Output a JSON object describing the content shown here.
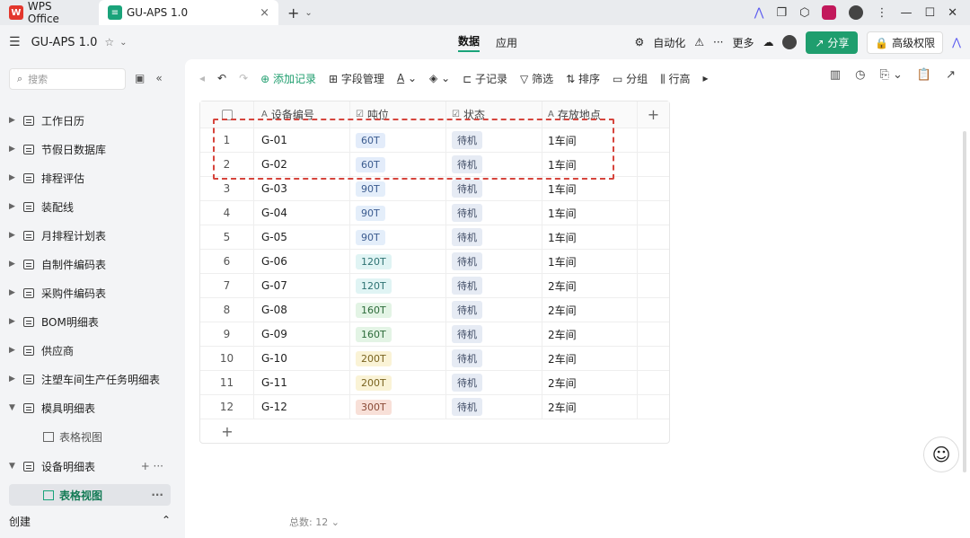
{
  "titlebar": {
    "wps_tab": "WPS Office",
    "doc_tab": "GU-APS 1.0",
    "close": "×",
    "new_tab": "+",
    "menu": "⌄"
  },
  "appbar": {
    "title": "GU-APS 1.0",
    "tabs": [
      {
        "label": "数据",
        "active": true
      },
      {
        "label": "应用",
        "active": false
      }
    ],
    "automation": "自动化",
    "more": "更多",
    "share": "分享",
    "permissions": "高级权限"
  },
  "sidebar": {
    "search_placeholder": "搜索",
    "items": [
      {
        "label": "工作日历"
      },
      {
        "label": "节假日数据库"
      },
      {
        "label": "排程评估"
      },
      {
        "label": "装配线"
      },
      {
        "label": "月排程计划表"
      },
      {
        "label": "自制件编码表"
      },
      {
        "label": "采购件编码表"
      },
      {
        "label": "BOM明细表"
      },
      {
        "label": "供应商"
      },
      {
        "label": "注塑车间生产任务明细表"
      },
      {
        "label": "模具明细表"
      },
      {
        "label": "表格视图"
      },
      {
        "label": "设备明细表"
      },
      {
        "label": "表格视图"
      }
    ],
    "create": "创建"
  },
  "toolbar": {
    "add_record": "添加记录",
    "field_manage": "字段管理",
    "text_a": "A",
    "sub_record": "子记录",
    "filter": "筛选",
    "sort": "排序",
    "group": "分组",
    "row_height": "行高"
  },
  "table": {
    "headers": [
      "设备编号",
      "吨位",
      "状态",
      "存放地点"
    ],
    "rows": [
      {
        "num": "1",
        "code": "G-01",
        "ton": "60T",
        "state": "待机",
        "loc": "1车间"
      },
      {
        "num": "2",
        "code": "G-02",
        "ton": "60T",
        "state": "待机",
        "loc": "1车间"
      },
      {
        "num": "3",
        "code": "G-03",
        "ton": "90T",
        "state": "待机",
        "loc": "1车间"
      },
      {
        "num": "4",
        "code": "G-04",
        "ton": "90T",
        "state": "待机",
        "loc": "1车间"
      },
      {
        "num": "5",
        "code": "G-05",
        "ton": "90T",
        "state": "待机",
        "loc": "1车间"
      },
      {
        "num": "6",
        "code": "G-06",
        "ton": "120T",
        "state": "待机",
        "loc": "1车间"
      },
      {
        "num": "7",
        "code": "G-07",
        "ton": "120T",
        "state": "待机",
        "loc": "2车间"
      },
      {
        "num": "8",
        "code": "G-08",
        "ton": "160T",
        "state": "待机",
        "loc": "2车间"
      },
      {
        "num": "9",
        "code": "G-09",
        "ton": "160T",
        "state": "待机",
        "loc": "2车间"
      },
      {
        "num": "10",
        "code": "G-10",
        "ton": "200T",
        "state": "待机",
        "loc": "2车间"
      },
      {
        "num": "11",
        "code": "G-11",
        "ton": "200T",
        "state": "待机",
        "loc": "2车间"
      },
      {
        "num": "12",
        "code": "G-12",
        "ton": "300T",
        "state": "待机",
        "loc": "2车间"
      }
    ]
  },
  "footer": {
    "total_label": "总数:",
    "total": "12"
  }
}
